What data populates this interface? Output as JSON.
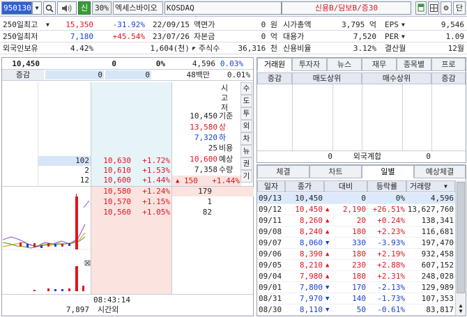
{
  "toolbar": {
    "code": "950130",
    "search_icon": "magnifier-icon",
    "sound_icon": "speaker-icon",
    "credit_badge": "신",
    "margin_rate": "30%",
    "name": "엑세스바이오",
    "market": "KOSDAQ",
    "credit_info": "신용B/담보B/증30",
    "right_icons": [
      "doc-icon",
      "grid-icon",
      "gear-icon"
    ],
    "single_label": "단"
  },
  "info": {
    "high250_label": "250일최고",
    "high250_price": "15,350",
    "high250_rate": "-31.92%",
    "high250_date": "22/09/15",
    "low250_label": "250일최저",
    "low250_price": "7,180",
    "low250_rate": "+45.54%",
    "low250_date": "23/07/26",
    "foreign_label": "외국인보유",
    "foreign_pct": "4.42%",
    "foreign_qty": "1,604(천)",
    "par_label": "액면가",
    "par_value": "0 원",
    "capital_label": "자본금",
    "capital_value": "0 억",
    "shares_label": "주식수",
    "shares_value": "36,316 천",
    "mcap_label": "시가총액",
    "mcap_value": "3,795 억",
    "sub_label": "대용가",
    "sub_value": "7,520",
    "credit_label": "신용비율",
    "credit_value": "3.12%",
    "eps_label": "EPS",
    "eps_value": "9,546",
    "per_label": "PER",
    "per_value": "1.09",
    "settle_label": "결산월",
    "settle_value": "12월"
  },
  "quote": {
    "price": "10,450",
    "change": "0",
    "rate": "0%",
    "volume": "4,596",
    "vol_rate": "0.03%",
    "chg_label": "증감",
    "chg_left": "0",
    "chg_right": "0",
    "amount": "48백만",
    "amount_rate": "0.01%"
  },
  "orderbook": {
    "asks": [
      {
        "qty": "102",
        "price": "10,630",
        "rate": "+1.72%"
      },
      {
        "qty": "2",
        "price": "10,610",
        "rate": "+1.53%"
      },
      {
        "qty": "12",
        "price": "10,600",
        "rate": "+1.44%"
      }
    ],
    "bids": [
      {
        "price": "10,580",
        "rate": "+1.24%",
        "qty": "179"
      },
      {
        "price": "10,570",
        "rate": "+1.15%",
        "qty": "1"
      },
      {
        "price": "10,560",
        "rate": "+1.05%",
        "qty": "82"
      }
    ],
    "side_labels": [
      "시",
      "고",
      "저"
    ],
    "base_price": "10,450",
    "base_label": "기준",
    "upper_price": "13,580",
    "upper_label": "상",
    "lower_price": "7,320",
    "lower_label": "하",
    "cost": "25",
    "cost_label": "비용",
    "expected_price": "10,600",
    "expected_label": "예상",
    "expected_qty": "7,358",
    "qty_label": "수량",
    "expected_change": "150",
    "expected_rate": "+1.44%",
    "vertical_tabs": [
      "수",
      "도",
      "투",
      "외",
      "차",
      "뉴",
      "권",
      "기"
    ],
    "time": "08:43:14",
    "after_qty": "7,897",
    "after_label": "시간외"
  },
  "broker": {
    "tabs": [
      "거래원",
      "투자자",
      "뉴스",
      "재무",
      "종목별",
      "프로"
    ],
    "headers": [
      "증감",
      "매도상위",
      "매수상위",
      "증감"
    ],
    "foreign_label": "외국계합",
    "foreign_left": "0",
    "foreign_right": "0"
  },
  "daily": {
    "tabs": [
      "체결",
      "차트",
      "일별",
      "예상체결"
    ],
    "headers": [
      "일자",
      "종가",
      "대비",
      "등락률",
      "거래량"
    ],
    "rows": [
      {
        "date": "09/13",
        "close": "10,450",
        "dir": "none",
        "diff": "0",
        "rate": "0%",
        "vol": "4,596",
        "color": "black"
      },
      {
        "date": "09/12",
        "close": "10,450",
        "dir": "up",
        "diff": "2,190",
        "rate": "+26.51%",
        "vol": "13,627,760",
        "color": "red"
      },
      {
        "date": "09/11",
        "close": "8,260",
        "dir": "up",
        "diff": "20",
        "rate": "+0.24%",
        "vol": "138,341",
        "color": "red"
      },
      {
        "date": "09/08",
        "close": "8,240",
        "dir": "up",
        "diff": "180",
        "rate": "+2.23%",
        "vol": "116,681",
        "color": "red"
      },
      {
        "date": "09/07",
        "close": "8,060",
        "dir": "down",
        "diff": "330",
        "rate": "-3.93%",
        "vol": "197,470",
        "color": "blue"
      },
      {
        "date": "09/06",
        "close": "8,390",
        "dir": "up",
        "diff": "180",
        "rate": "+2.19%",
        "vol": "932,458",
        "color": "red"
      },
      {
        "date": "09/05",
        "close": "8,210",
        "dir": "up",
        "diff": "230",
        "rate": "+2.88%",
        "vol": "607,152",
        "color": "red"
      },
      {
        "date": "09/04",
        "close": "7,980",
        "dir": "up",
        "diff": "180",
        "rate": "+2.31%",
        "vol": "248,028",
        "color": "red"
      },
      {
        "date": "09/01",
        "close": "7,800",
        "dir": "down",
        "diff": "170",
        "rate": "-2.13%",
        "vol": "129,989",
        "color": "blue"
      },
      {
        "date": "08/31",
        "close": "7,970",
        "dir": "down",
        "diff": "140",
        "rate": "-1.73%",
        "vol": "107,353",
        "color": "blue"
      },
      {
        "date": "08/30",
        "close": "8,110",
        "dir": "down",
        "diff": "50",
        "rate": "-0.61%",
        "vol": "83,817",
        "color": "blue"
      }
    ]
  },
  "colors": {
    "up": "#e0141e",
    "down": "#1a3fd0",
    "ask_bg": "#e6f3f7",
    "bid_bg": "#fbe3df",
    "sel_bg": "#dbe9fb"
  }
}
